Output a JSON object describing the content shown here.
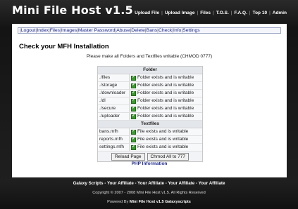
{
  "header": {
    "title": "Mini File Host v1.5",
    "nav": [
      "Upload File",
      "Upload Image",
      "Files",
      "T.O.S.",
      "F.A.Q.",
      "Top 10",
      "Admin"
    ]
  },
  "subnav": {
    "items": [
      "Logout",
      "Index",
      "Files",
      "Images",
      "Master Password",
      "Abuse",
      "Delete",
      "Bans",
      "Check",
      "Info",
      "Settings"
    ]
  },
  "main": {
    "title": "Check your MFH Installation",
    "note": "Please make all Folders and Textfiles writable (CHMOD 0777)",
    "folder_header": "Folder",
    "folders": [
      {
        "name": "./files",
        "status": "Folder exists and is writable"
      },
      {
        "name": "./storage",
        "status": "Folder exists and is writable"
      },
      {
        "name": "./downloader",
        "status": "Folder exists and is writable"
      },
      {
        "name": "./dl",
        "status": "Folder exists and is writable"
      },
      {
        "name": "./secure",
        "status": "Folder exists and is writable"
      },
      {
        "name": "./uploader",
        "status": "Folder exists and is writable"
      }
    ],
    "textfile_header": "Textfiles",
    "textfiles": [
      {
        "name": "bans.mfh",
        "status": "File exists and is writable"
      },
      {
        "name": "reports.mfh",
        "status": "File exists and is writable"
      },
      {
        "name": "settings.mfh",
        "status": "File exists and is writable"
      }
    ],
    "reload_button": "Reload Page",
    "chmod_button": "Chmod All to 777",
    "php_link": "PHP Information"
  },
  "footer": {
    "links": "Galaxy Scripts - Your Affiliate - Your Affiliate - Your Affiliate - Your Affiliate",
    "copyright": "Copyright © 2007 - 2008 Mini File Host v1.5. All Rights Reserved",
    "powered_prefix": "Powered By",
    "powered_name": "Mini File Host v1.5 Galaxyscripts"
  },
  "colors": {
    "ok_icon": "#3b9a2e",
    "link": "#1f2a8a"
  }
}
